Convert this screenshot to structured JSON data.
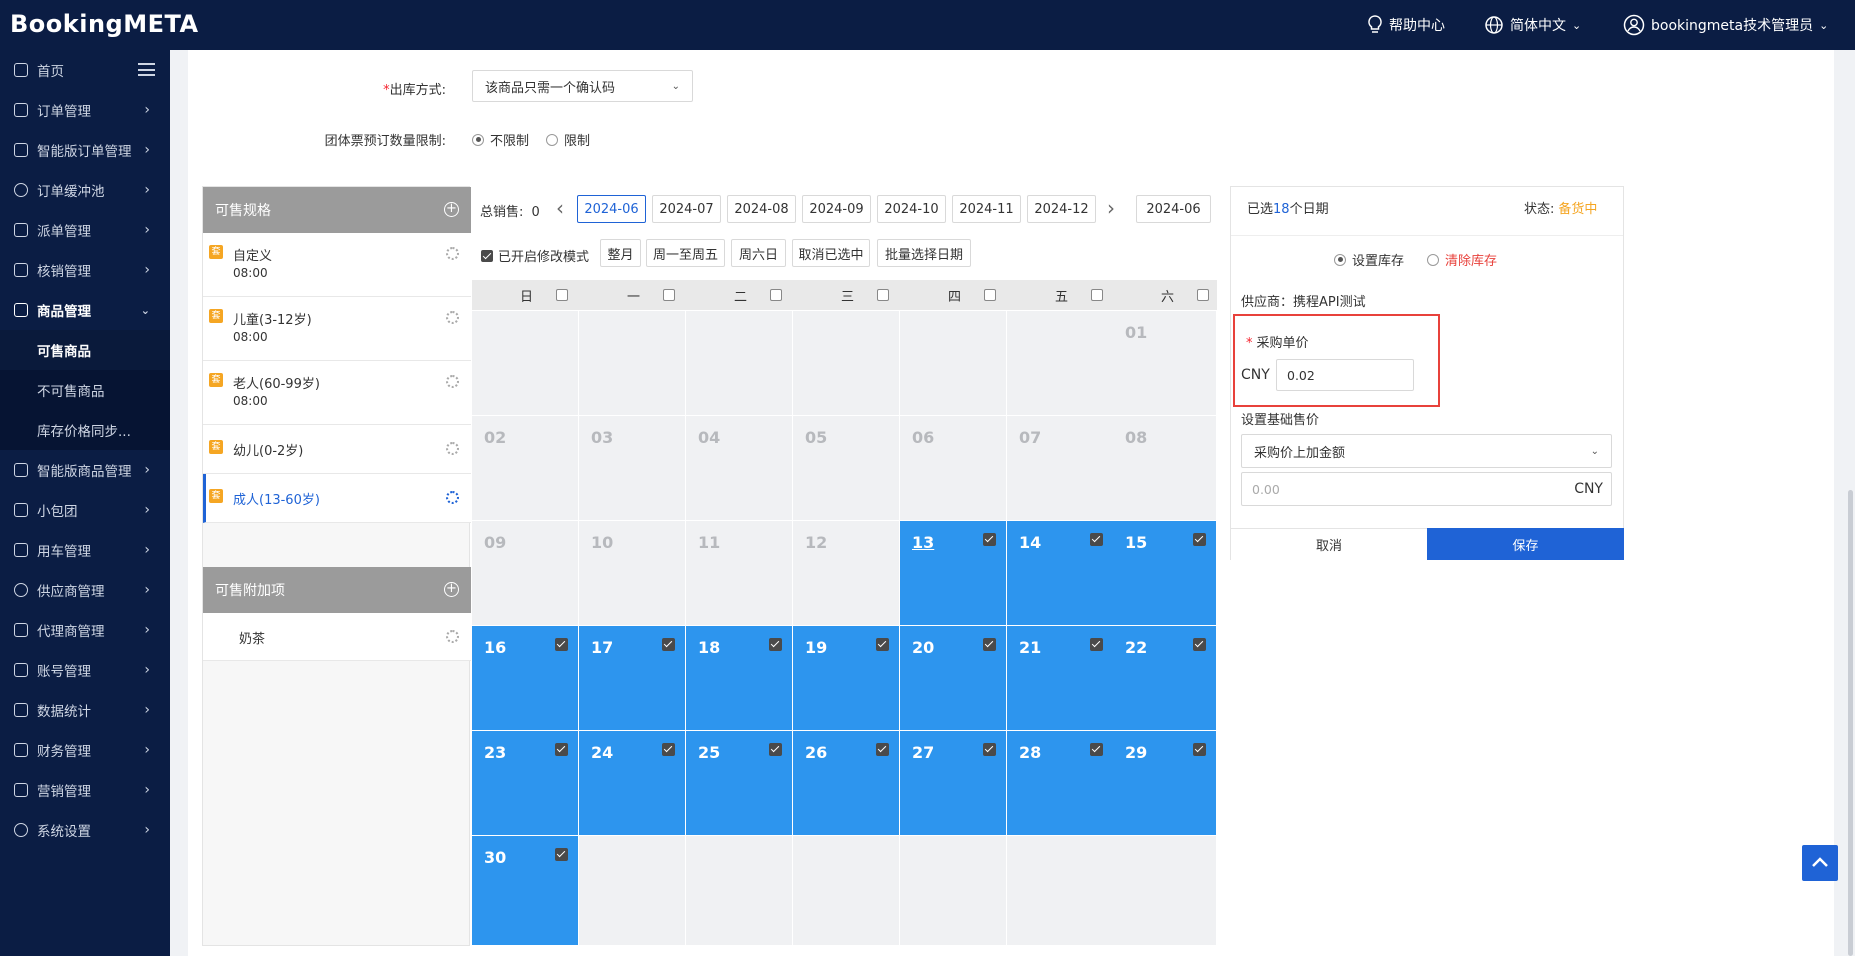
{
  "header": {
    "logo": "BookingMETA",
    "help": "帮助中心",
    "language": "简体中文",
    "user": "bookingmeta技术管理员"
  },
  "sidebar": {
    "items": [
      {
        "label": "首页",
        "icon": "home-icon"
      },
      {
        "label": "订单管理",
        "icon": "order-icon"
      },
      {
        "label": "智能版订单管理",
        "icon": "smart-order-icon"
      },
      {
        "label": "订单缓冲池",
        "icon": "buffer-icon"
      },
      {
        "label": "派单管理",
        "icon": "dispatch-icon"
      },
      {
        "label": "核销管理",
        "icon": "verify-icon"
      },
      {
        "label": "商品管理",
        "icon": "product-icon"
      },
      {
        "label": "智能版商品管理",
        "icon": "smart-product-icon"
      },
      {
        "label": "小包团",
        "icon": "group-icon"
      },
      {
        "label": "用车管理",
        "icon": "car-icon"
      },
      {
        "label": "供应商管理",
        "icon": "supplier-icon"
      },
      {
        "label": "代理商管理",
        "icon": "agent-icon"
      },
      {
        "label": "账号管理",
        "icon": "account-icon"
      },
      {
        "label": "数据统计",
        "icon": "chart-icon"
      },
      {
        "label": "财务管理",
        "icon": "finance-icon"
      },
      {
        "label": "营销管理",
        "icon": "marketing-icon"
      },
      {
        "label": "系统设置",
        "icon": "settings-icon"
      }
    ],
    "subitems": [
      "可售商品",
      "不可售商品",
      "库存价格同步..."
    ]
  },
  "form": {
    "outbound_label": "出库方式:",
    "outbound_value": "该商品只需一个确认码",
    "group_limit_label": "团体票预订数量限制:",
    "no_limit": "不限制",
    "limit": "限制"
  },
  "specs": {
    "title": "可售规格",
    "items": [
      {
        "badge": "套",
        "name": "自定义",
        "time": "08:00"
      },
      {
        "badge": "套",
        "name": "儿童(3-12岁)",
        "time": "08:00"
      },
      {
        "badge": "套",
        "name": "老人(60-99岁)",
        "time": "08:00"
      },
      {
        "badge": "套",
        "name": "幼儿(0-2岁)",
        "time": ""
      },
      {
        "badge": "套",
        "name": "成人(13-60岁)",
        "time": ""
      }
    ],
    "addon_title": "可售附加项",
    "addons": [
      "奶茶"
    ]
  },
  "calendar": {
    "total_sales_label": "总销售:",
    "total_sales": "0",
    "months": [
      "2024-06",
      "2024-07",
      "2024-08",
      "2024-09",
      "2024-10",
      "2024-11",
      "2024-12"
    ],
    "current_month": "2024-06",
    "edit_mode": "已开启修改模式",
    "btn_whole_month": "整月",
    "btn_weekdays": "周一至周五",
    "btn_weekend": "周六日",
    "btn_cancel_selected": "取消已选中",
    "btn_batch_select": "批量选择日期",
    "weekdays": [
      "日",
      "一",
      "二",
      "三",
      "四",
      "五",
      "六"
    ],
    "days": [
      "01",
      "02",
      "03",
      "04",
      "05",
      "06",
      "07",
      "08",
      "09",
      "10",
      "11",
      "12",
      "13",
      "14",
      "15",
      "16",
      "17",
      "18",
      "19",
      "20",
      "21",
      "22",
      "23",
      "24",
      "25",
      "26",
      "27",
      "28",
      "29",
      "30"
    ],
    "selected_from": 13
  },
  "right_panel": {
    "selected_prefix": "已选",
    "selected_count": "18",
    "selected_suffix": "个日期",
    "status_label": "状态:",
    "status_value": "备货中",
    "set_stock": "设置库存",
    "clear_stock": "清除库存",
    "supplier": "供应商：携程API测试",
    "purchase_price_label": "采购单价",
    "currency": "CNY",
    "purchase_price": "0.02",
    "base_price_label": "设置基础售价",
    "base_price_mode": "采购价上加金额",
    "base_price_placeholder": "0.00",
    "cancel": "取消",
    "save": "保存"
  },
  "colors": {
    "brand_dark": "#0b1d44",
    "accent": "#1f63d6",
    "selected_day": "#2d95ee",
    "status": "#f5a623",
    "danger": "#e8413b"
  }
}
